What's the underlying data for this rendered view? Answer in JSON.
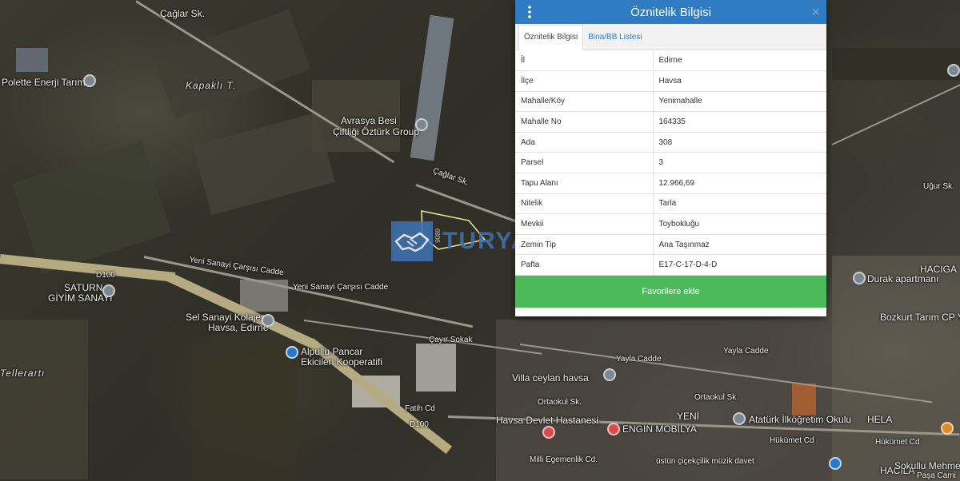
{
  "map": {
    "labels": {
      "caglar_sk_top": "Çağlar Sk.",
      "kapakli": "Kapaklı T.",
      "polette": "Polette Enerji Tarım",
      "avrasya": "Avrasya Besi",
      "ciftligi": "Çiftliği Öztürk Group",
      "caglar_sk_mid": "Çağlar Sk.",
      "yeni_sanayi_1": "Yeni Sanayi Çarşısı Cadde",
      "yeni_sanayi_2": "Yeni Sanayi Çarşısı Cadde",
      "d100_left": "D100",
      "saturn": "SATURN",
      "giyim": "GİYİM SANAYİ",
      "sel_sanayi": "Sel Sanayi Kolajen",
      "havsa_edirne": "Havsa, Edirne",
      "alpullu": "Alpullu Pancar",
      "ekicileri": "Ekicileri Kooperatifi",
      "tellerarti": "Tellerartı",
      "cayir_sokak": "Çayır Sokak",
      "fatih_cd": "Fatih Cd",
      "d100_bottom": "D100",
      "villa_ceylan": "Villa ceylan havsa",
      "ortaokul_sk": "Ortaokul Sk.",
      "havsa_devlet": "Havsa Devlet Hastanesi",
      "engin_mobilya": "ENGİN MOBİLYA",
      "milli_egemenlik": "Milli Egemenlik Cd.",
      "yayla_cadde_1": "Yayla Cadde",
      "yayla_cadde_2": "Yayla Cadde",
      "ortaokul_sk_2": "Ortaokul Sk.",
      "ataturk": "Atatürk İlköğretim Okulu",
      "hukumet_cd": "Hükümet Cd",
      "hukumet_cd_2": "Hükümet Cd",
      "ustun_cicekcilik": "üstün çiçekçilik müzik davet",
      "durak": "Durak apartmanı",
      "bozkurt": "Bozkurt Tarım CP Ye",
      "hacigazi": "HACIGA",
      "hacilar": "HACILA",
      "hela": "HELA",
      "yeni": "YENİ",
      "sokullu": "Sokullu Mehmet",
      "pasa_cami": "Paşa Cami",
      "ugur_sk": "Uğur Sk."
    }
  },
  "watermark": {
    "brand": "TURYAP",
    "code": "9089"
  },
  "panel": {
    "title": "Öznitelik Bilgisi",
    "close_label": "×",
    "tabs": [
      {
        "label": "Öznitelik Bilgisi",
        "active": true
      },
      {
        "label": "Bina/BB Listesi",
        "active": false
      }
    ],
    "rows": [
      {
        "key": "İl",
        "value": "Edirne"
      },
      {
        "key": "İlçe",
        "value": "Havsa"
      },
      {
        "key": "Mahalle/Köy",
        "value": "Yenimahalle"
      },
      {
        "key": "Mahalle No",
        "value": "164335"
      },
      {
        "key": "Ada",
        "value": "308"
      },
      {
        "key": "Parsel",
        "value": "3"
      },
      {
        "key": "Tapu Alanı",
        "value": "12.966,69"
      },
      {
        "key": "Nitelik",
        "value": "Tarla"
      },
      {
        "key": "Mevkii",
        "value": "Toybokluğu"
      },
      {
        "key": "Zemin Tip",
        "value": "Ana Taşınmaz"
      },
      {
        "key": "Pafta",
        "value": "E17-C-17-D-4-D"
      }
    ],
    "favorite_button": "Favorilere ekle"
  },
  "colors": {
    "header": "#2f7cc2",
    "button": "#4cba5a",
    "tab_link": "#2f7cc2",
    "watermark": "#3f74b6"
  }
}
